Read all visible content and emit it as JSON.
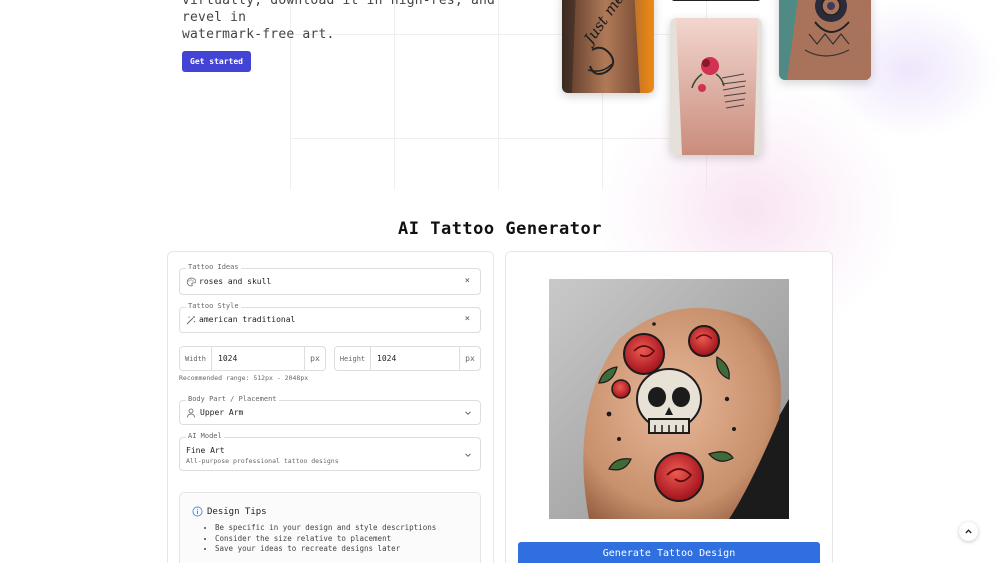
{
  "hero": {
    "text_line1": "virtually, download it in high-res, and revel in",
    "text_line2": "watermark-free art.",
    "cta_label": "Get started"
  },
  "gallery": {
    "tattoo_script_text": "Just me"
  },
  "generator": {
    "title": "AI Tattoo Generator",
    "ideas": {
      "label": "Tattoo Ideas",
      "value": "roses and skull",
      "icon": "palette-icon",
      "clear": "×"
    },
    "style": {
      "label": "Tattoo Style",
      "value": "american traditional",
      "icon": "magic-wand-icon",
      "clear": "×"
    },
    "width": {
      "label": "Width",
      "value": "1024",
      "unit": "px"
    },
    "height": {
      "label": "Height",
      "value": "1024",
      "unit": "px"
    },
    "size_hint": "Recommended range: 512px - 2048px",
    "placement": {
      "label": "Body Part / Placement",
      "value": "Upper Arm",
      "icon": "person-icon"
    },
    "model": {
      "label": "AI Model",
      "value": "Fine Art",
      "description": "All-purpose professional tattoo designs"
    },
    "tips": {
      "title": "Design Tips",
      "items": [
        "Be specific in your design and style descriptions",
        "Consider the size relative to placement",
        "Save your ideas to recreate designs later"
      ]
    },
    "generate_label": "Generate Tattoo Design"
  },
  "colors": {
    "accent": "#4343d6",
    "primary_button": "#2f6fe0",
    "rose_red": "#c8222a"
  }
}
